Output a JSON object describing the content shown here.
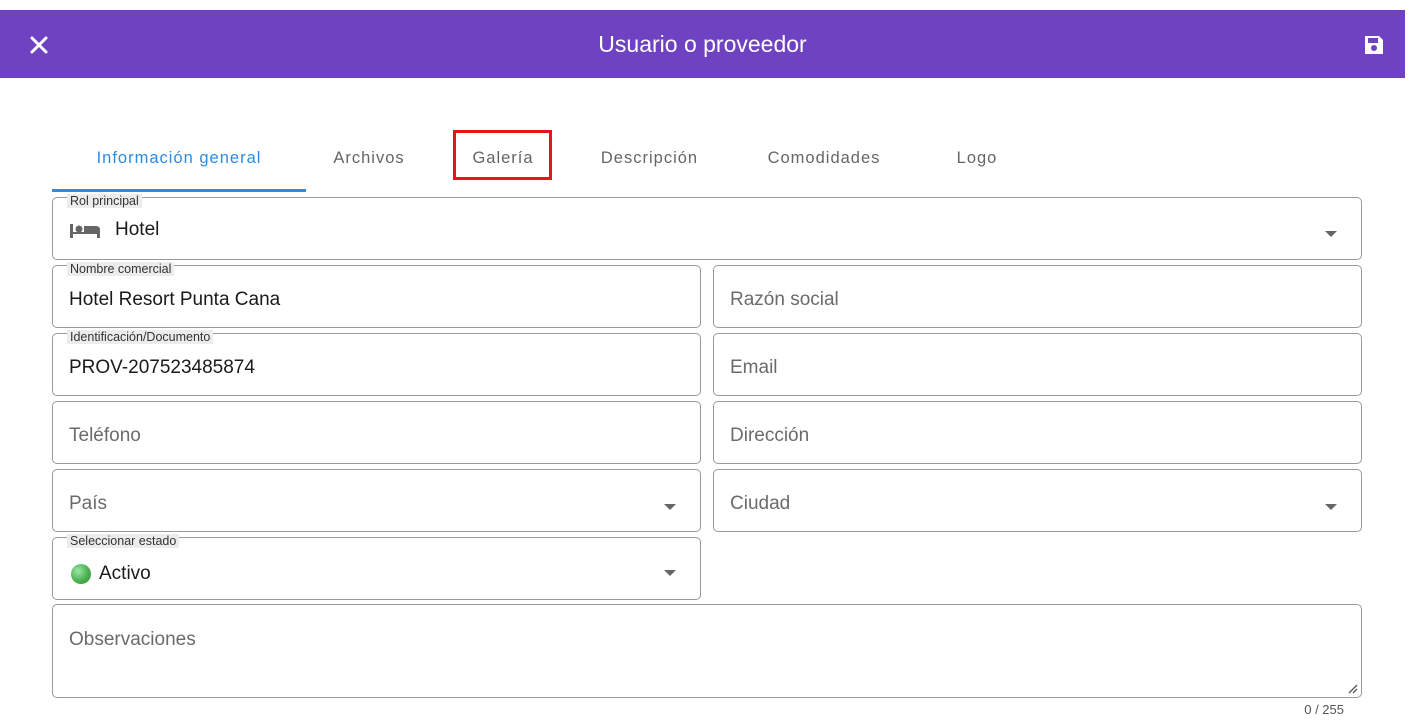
{
  "header": {
    "title": "Usuario o proveedor",
    "bg_color": "#6f42c1",
    "close_icon": "close-icon",
    "save_icon": "save-icon"
  },
  "tabs": [
    {
      "label": "Información general",
      "active": true
    },
    {
      "label": "Archivos",
      "active": false
    },
    {
      "label": "Galería",
      "active": false,
      "highlighted": true
    },
    {
      "label": "Descripción",
      "active": false
    },
    {
      "label": "Comodidades",
      "active": false
    },
    {
      "label": "Logo",
      "active": false
    }
  ],
  "form": {
    "rol_principal": {
      "label": "Rol principal",
      "value": "Hotel",
      "icon": "bed-icon"
    },
    "nombre_comercial": {
      "label": "Nombre comercial",
      "value": "Hotel Resort Punta Cana"
    },
    "razon_social": {
      "placeholder": "Razón social"
    },
    "identificacion": {
      "label": "Identificación/Documento",
      "value": "PROV-207523485874"
    },
    "email": {
      "placeholder": "Email"
    },
    "telefono": {
      "placeholder": "Teléfono"
    },
    "direccion": {
      "placeholder": "Dirección"
    },
    "pais": {
      "placeholder": "País"
    },
    "ciudad": {
      "placeholder": "Ciudad"
    },
    "estado": {
      "label": "Seleccionar estado",
      "value": "Activo",
      "status_color": "#4caf50"
    },
    "observaciones": {
      "placeholder": "Observaciones",
      "counter": "0 / 255"
    }
  },
  "colors": {
    "accent": "#2d8be0",
    "highlight": "#e4161b"
  }
}
